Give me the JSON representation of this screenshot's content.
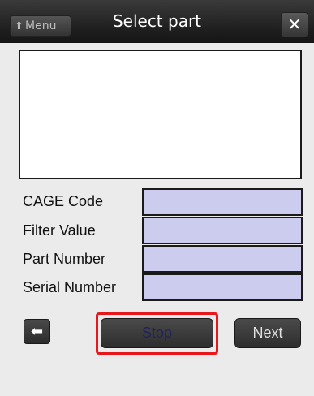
{
  "header": {
    "menu_label": "Menu",
    "title": "Select part",
    "close_glyph": "✕"
  },
  "fields": [
    {
      "label": "CAGE Code",
      "value": ""
    },
    {
      "label": "Filter Value",
      "value": ""
    },
    {
      "label": "Part Number",
      "value": ""
    },
    {
      "label": "Serial Number",
      "value": ""
    }
  ],
  "footer": {
    "back_glyph": "⬅",
    "stop_label": "Stop",
    "next_label": "Next"
  },
  "icons": {
    "menu": "up-arrow-icon",
    "close": "close-icon",
    "back": "left-arrow-icon"
  },
  "colors": {
    "highlight": "#e8171b",
    "input_bg": "#ccccee",
    "titlebar": "#222222"
  }
}
